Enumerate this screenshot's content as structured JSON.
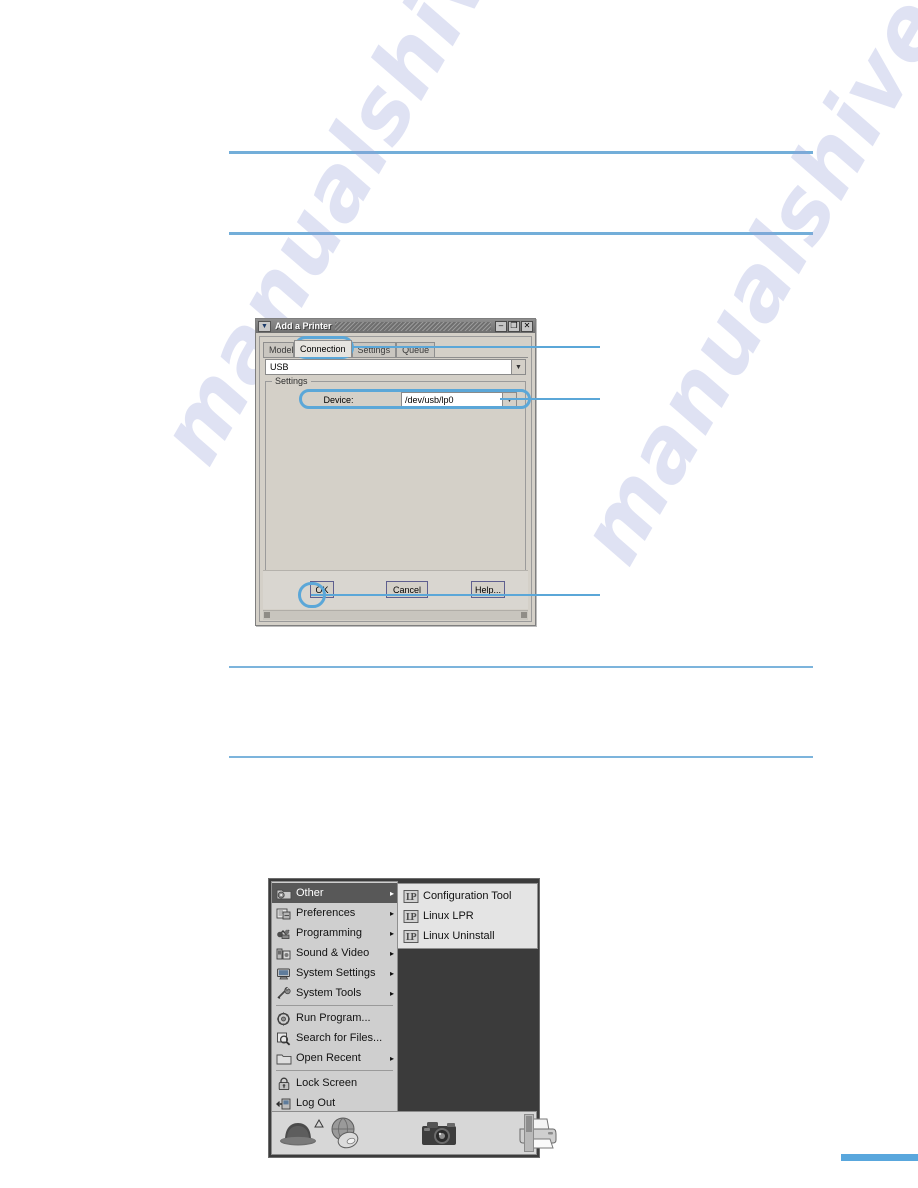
{
  "page": {
    "watermark_text": "manualshive.com"
  },
  "dialog": {
    "title": "Add a Printer",
    "titlebar_buttons": {
      "menu": "▼",
      "minimize": "–",
      "maximize": "❐",
      "close": "✕"
    },
    "tabs": [
      {
        "label": "Model",
        "active": false
      },
      {
        "label": "Connection",
        "active": true
      },
      {
        "label": "Settings",
        "active": false
      },
      {
        "label": "Queue",
        "active": false
      }
    ],
    "connection_select": {
      "value": "USB",
      "arrow": "▼"
    },
    "settings_group": {
      "label": "Settings",
      "device_label": "Device:",
      "device_value": "/dev/usb/lp0",
      "device_arrow": "▼"
    },
    "buttons": {
      "ok": "OK",
      "cancel": "Cancel",
      "help": "Help..."
    }
  },
  "callouts": {
    "tab_highlight": "Connection",
    "device_highlight": "Device",
    "ok_highlight": "OK"
  },
  "gnome": {
    "menu_items": [
      {
        "label": "Other",
        "icon": "folder-gear-icon",
        "arrow": "▸",
        "selected": true,
        "separator_after": false
      },
      {
        "label": "Preferences",
        "icon": "preferences-icon",
        "arrow": "▸",
        "selected": false,
        "separator_after": false
      },
      {
        "label": "Programming",
        "icon": "programming-icon",
        "arrow": "▸",
        "selected": false,
        "separator_after": false
      },
      {
        "label": "Sound & Video",
        "icon": "sound-video-icon",
        "arrow": "▸",
        "selected": false,
        "separator_after": false
      },
      {
        "label": "System Settings",
        "icon": "system-settings-icon",
        "arrow": "▸",
        "selected": false,
        "separator_after": false
      },
      {
        "label": "System Tools",
        "icon": "system-tools-icon",
        "arrow": "▸",
        "selected": false,
        "separator_after": true
      },
      {
        "label": "Run Program...",
        "icon": "run-program-icon",
        "arrow": "",
        "selected": false,
        "separator_after": false
      },
      {
        "label": "Search for Files...",
        "icon": "search-icon",
        "arrow": "",
        "selected": false,
        "separator_after": false
      },
      {
        "label": "Open Recent",
        "icon": "folder-icon",
        "arrow": "▸",
        "selected": false,
        "separator_after": true
      },
      {
        "label": "Lock Screen",
        "icon": "lock-icon",
        "arrow": "",
        "selected": false,
        "separator_after": false
      },
      {
        "label": "Log Out",
        "icon": "logout-icon",
        "arrow": "",
        "selected": false,
        "separator_after": false
      }
    ],
    "submenu_items": [
      {
        "label": "Configuration Tool",
        "icon": "lp-icon"
      },
      {
        "label": "Linux LPR",
        "icon": "lp-icon"
      },
      {
        "label": "Linux Uninstall",
        "icon": "lp-icon"
      }
    ],
    "taskbar_icons": [
      {
        "name": "red-hat-icon"
      },
      {
        "name": "globe-mouse-icon"
      },
      {
        "name": "camera-icon"
      },
      {
        "name": "printer-icon"
      }
    ]
  },
  "colors": {
    "accent_rule": "#73aed9",
    "callout": "#5ba7d8",
    "dialog_face": "#d4d0c8",
    "menu_face": "#cfcfcf",
    "desktop": "#3b3b3b"
  }
}
